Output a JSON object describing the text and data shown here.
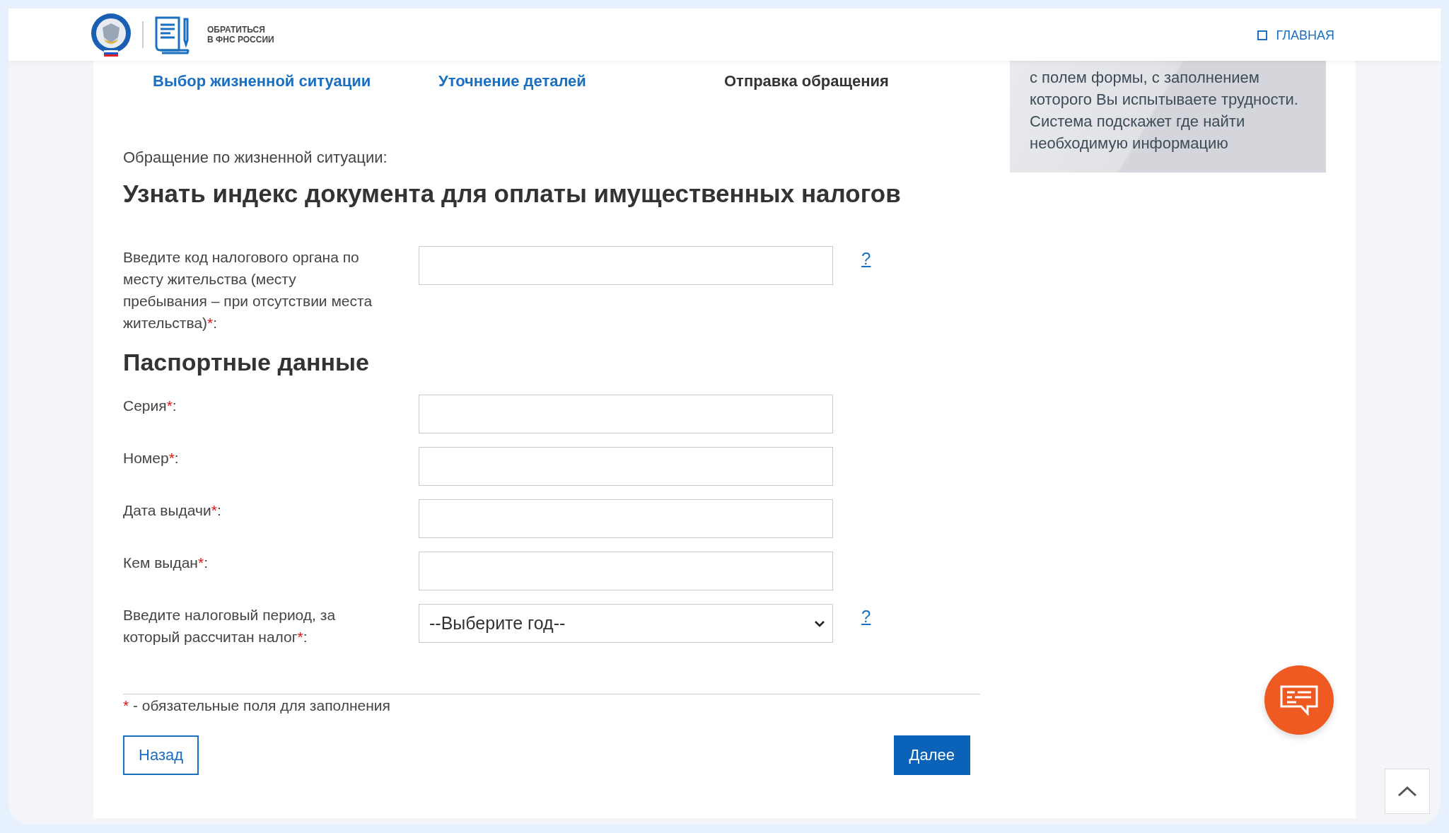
{
  "header": {
    "service_title": "ОБРАТИТЬСЯ\nВ ФНС РОССИИ",
    "nav_link": "ГЛАВНАЯ"
  },
  "steps": [
    {
      "label": "Выбор жизненной ситуации",
      "selected": false
    },
    {
      "label": "Уточнение деталей",
      "selected": false
    },
    {
      "label": "Отправка обращения",
      "selected": true
    }
  ],
  "hint_panel": {
    "text": "с полем формы, с заполнением которого Вы испытываете трудности. Система подскажет где найти необходимую информацию"
  },
  "form": {
    "subtitle": "Обращение по жизненной ситуации:",
    "title": "Узнать индекс документа для оплаты имущественных налогов",
    "fields": [
      {
        "kind": "input",
        "label": "Введите код налогового органа по месту жительства (месту пребывания – при отсутствии места жительства)",
        "required": true,
        "suffix": ":",
        "help": "?"
      },
      {
        "kind": "section",
        "label": "Паспортные данные"
      },
      {
        "kind": "input",
        "label": "Серия",
        "required": true,
        "suffix": ":"
      },
      {
        "kind": "input",
        "label": "Номер",
        "required": true,
        "suffix": ":"
      },
      {
        "kind": "input",
        "label": "Дата выдачи",
        "required": true,
        "suffix": ":"
      },
      {
        "kind": "input",
        "label": "Кем выдан",
        "required": true,
        "suffix": ":"
      },
      {
        "kind": "select",
        "label": "Введите налоговый период, за который рассчитан налог",
        "required": true,
        "suffix": ":",
        "value": "--Выберите год--",
        "help": "?"
      }
    ],
    "required_note_mark": "*",
    "required_note": " - обязательные поля для заполнения",
    "back_button": "Назад",
    "next_button": "Далее"
  }
}
